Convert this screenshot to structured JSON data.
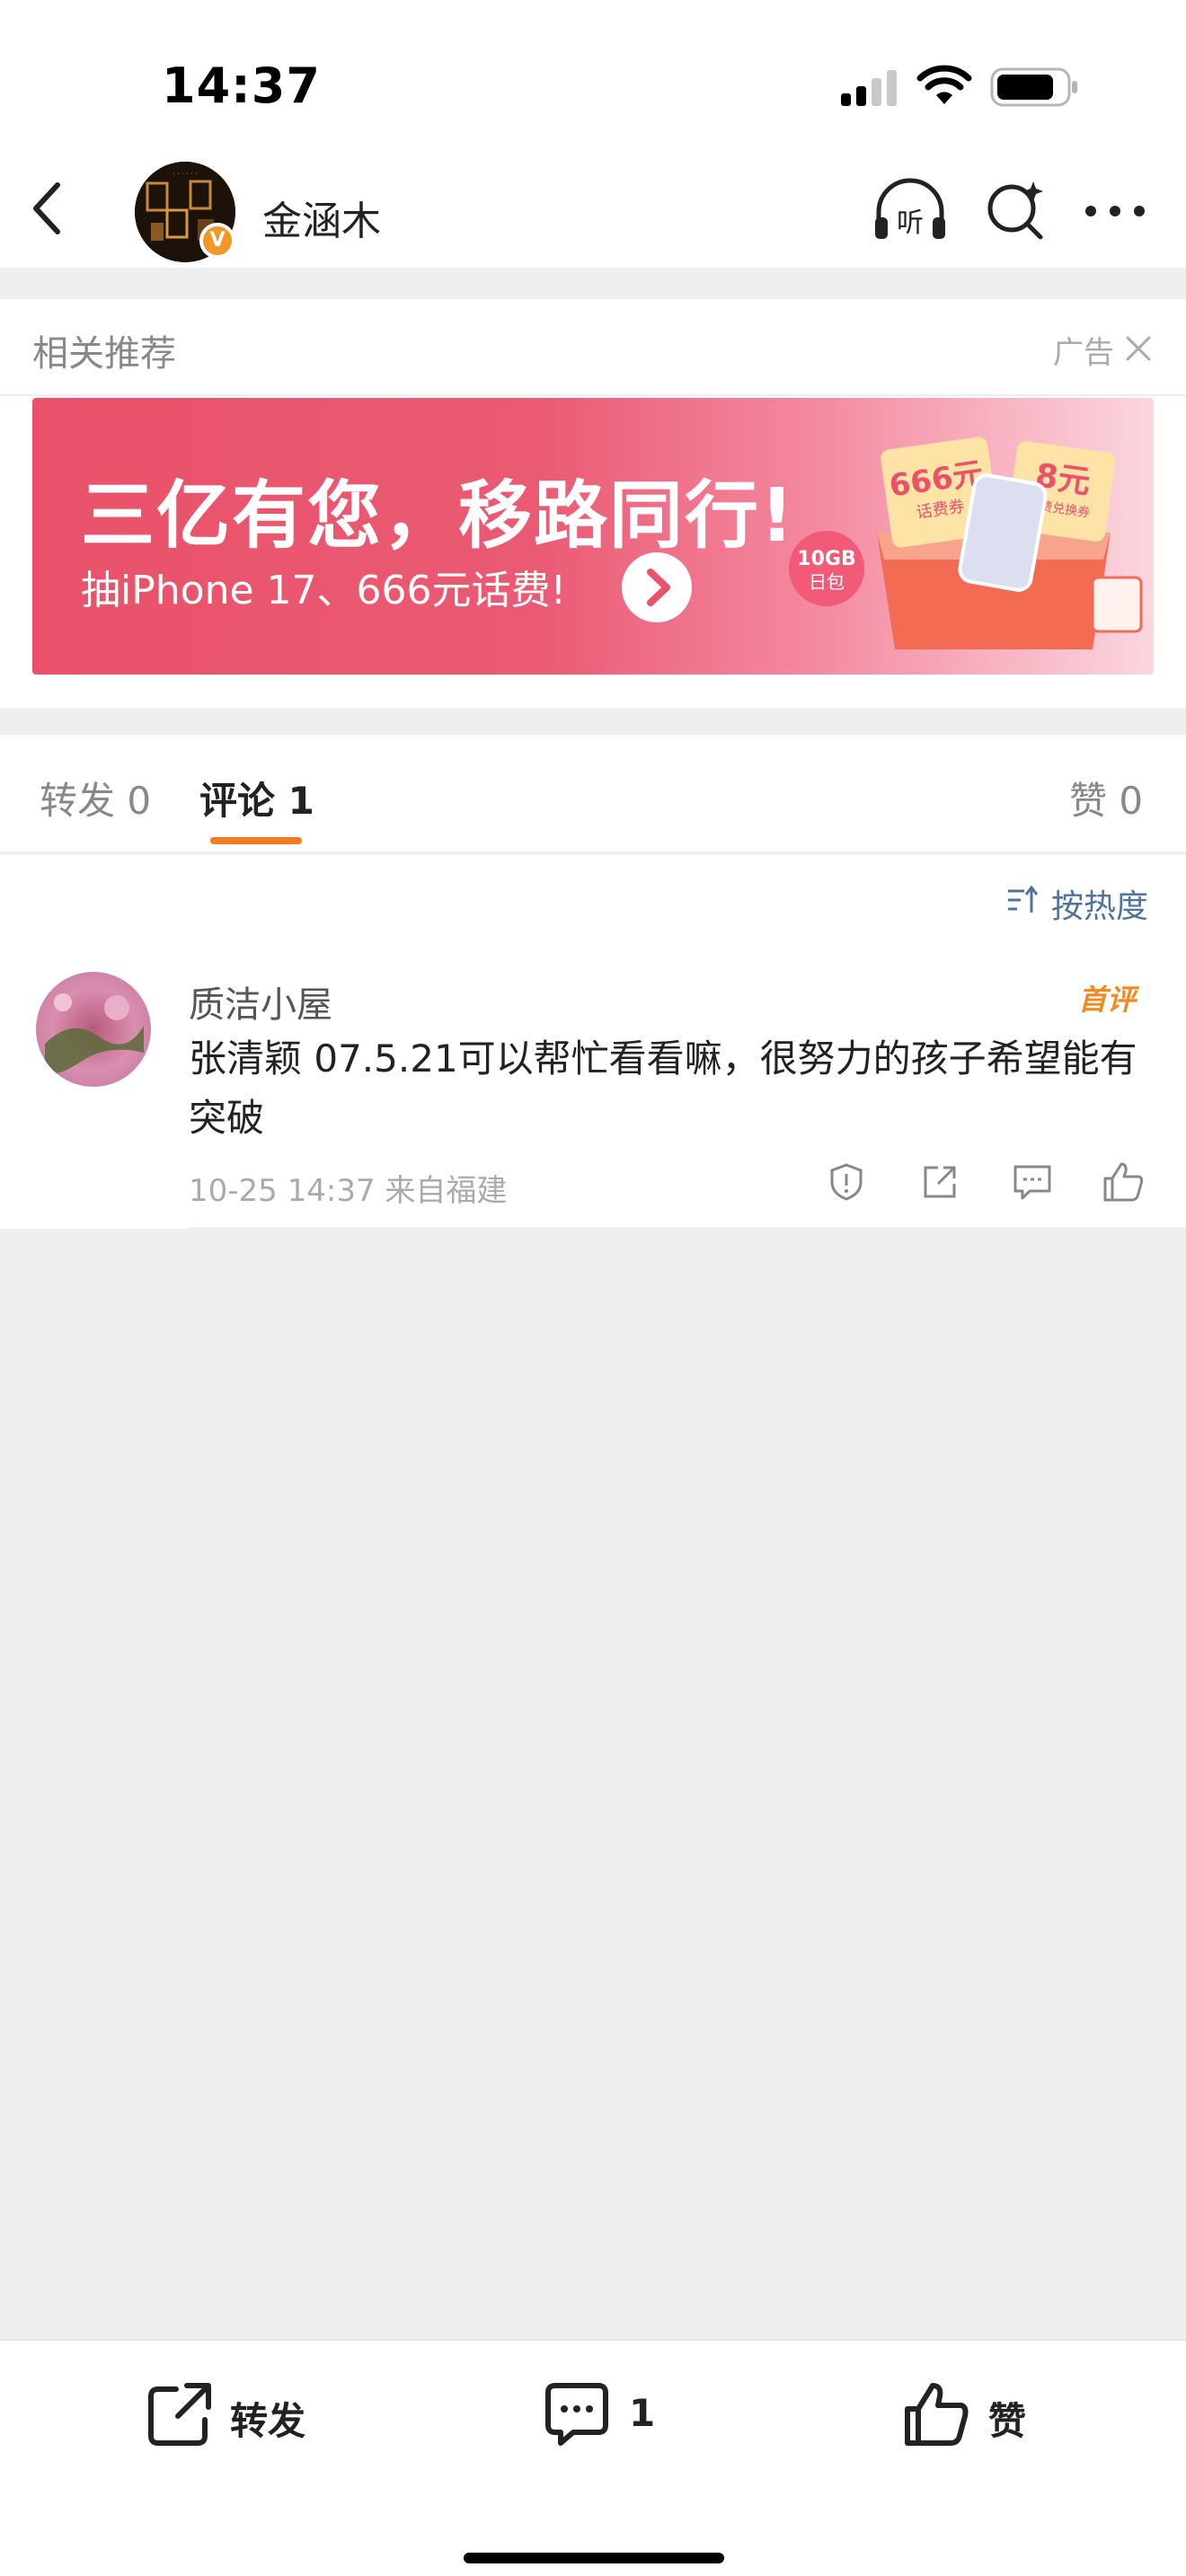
{
  "status_bar": {
    "time": "14:37"
  },
  "header": {
    "user_name": "金涵木",
    "verified_badge": "V"
  },
  "recommendation": {
    "title": "相关推荐",
    "ad_label": "广告",
    "banner": {
      "headline": "三亿有您，移路同行!",
      "subline": "抽iPhone 17、666元话费!",
      "tag_666": "666元",
      "tag_666_sub": "话费券",
      "tag_8": "8元",
      "tag_8_sub": "话费兑换券",
      "tag_10gb": "10GB",
      "tag_10gb_sub": "日包"
    }
  },
  "tabs": {
    "repost": "转发 0",
    "comment": "评论 1",
    "like": "赞 0"
  },
  "comments": {
    "sort_label": "按热度",
    "items": [
      {
        "name": "质洁小屋",
        "badge": "首评",
        "text": "张清颖 07.5.21可以帮忙看看嘛，很努力的孩子希望能有突破",
        "meta": "10-25 14:37  来自福建"
      }
    ]
  },
  "bottom_bar": {
    "repost_label": "转发",
    "comment_count": "1",
    "like_label": "赞"
  },
  "colors": {
    "accent_orange": "#f07d22",
    "link_blue": "#50739c",
    "banner_red": "#e9526a"
  }
}
